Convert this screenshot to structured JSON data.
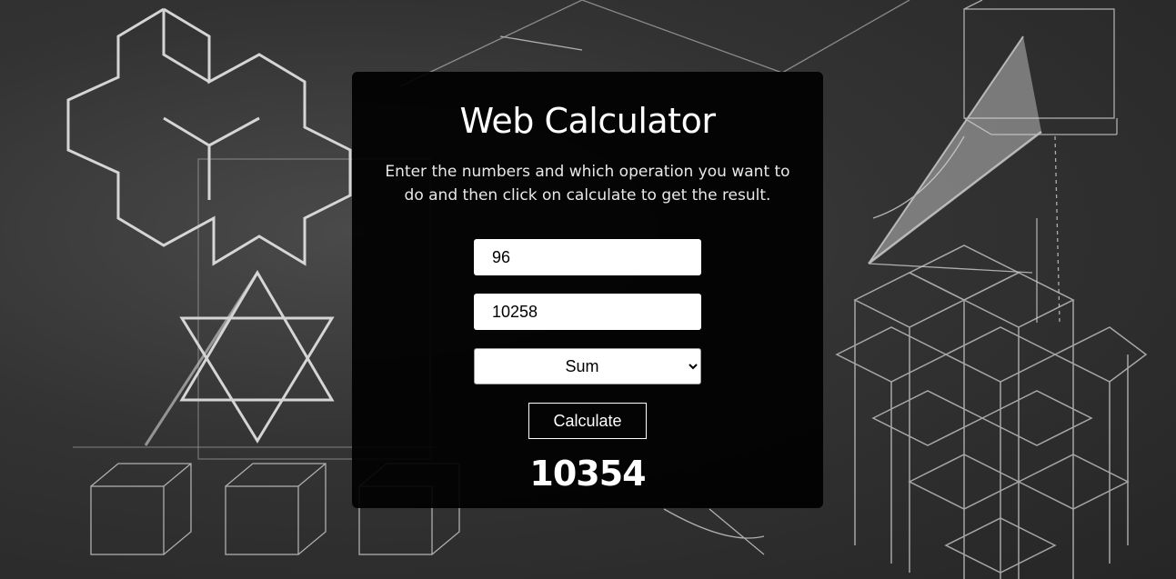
{
  "page": {
    "title": "Web Calculator",
    "description": "Enter the numbers and which operation you want to do and then click on calculate to get the result."
  },
  "form": {
    "first_number": "96",
    "second_number": "10258",
    "operation_selected": "Sum",
    "calculate_label": "Calculate"
  },
  "result": {
    "value": "10354"
  },
  "colors": {
    "card_background": "#000000",
    "text": "#ffffff",
    "chalkboard": "#2b2b2b"
  }
}
